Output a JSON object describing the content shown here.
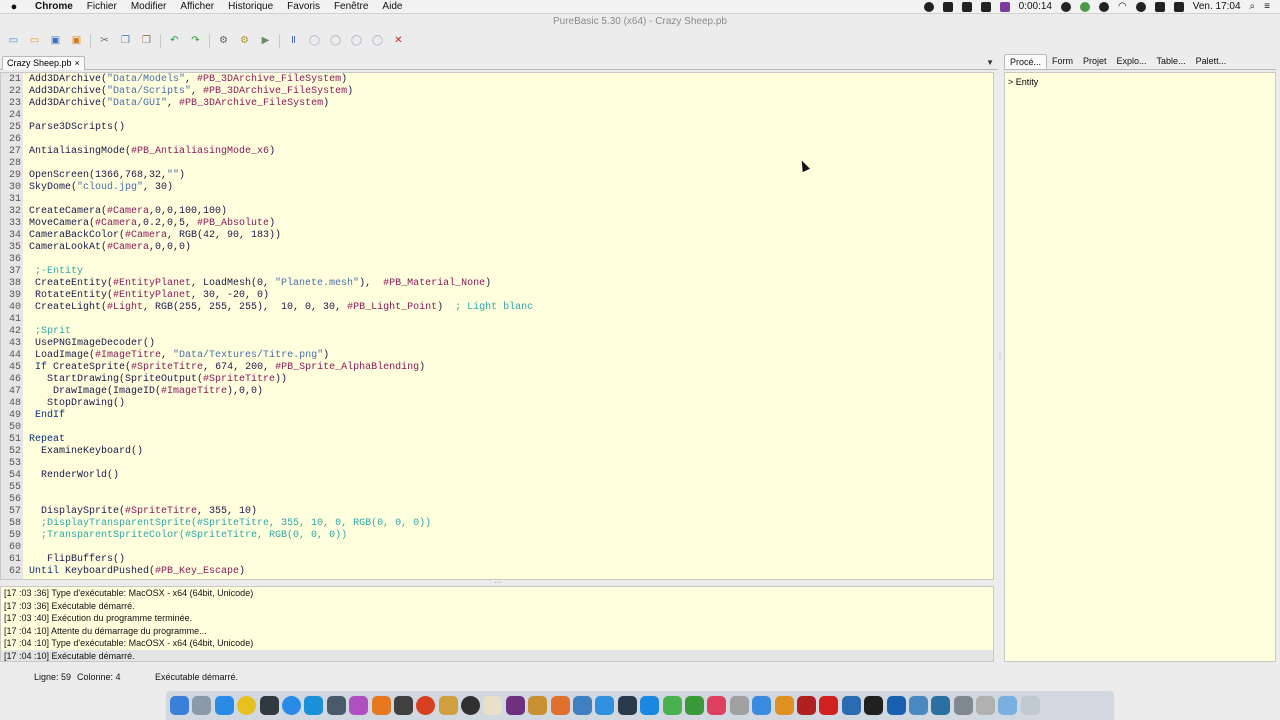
{
  "menubar": {
    "app": "Chrome",
    "items": [
      "Fichier",
      "Modifier",
      "Afficher",
      "Historique",
      "Favoris",
      "Fenêtre",
      "Aide"
    ],
    "timer": "0:00:14",
    "clock": "Ven. 17:04"
  },
  "window": {
    "title": "PureBasic 5.30 (x64) - Crazy Sheep.pb"
  },
  "toolbar": {
    "buttons": [
      {
        "name": "new-file-icon",
        "glyph": "▭",
        "color": "#4a7fd0"
      },
      {
        "name": "open-file-icon",
        "glyph": "▭",
        "color": "#e0a020"
      },
      {
        "name": "save-icon",
        "glyph": "▣",
        "color": "#3a70c0"
      },
      {
        "name": "save-all-icon",
        "glyph": "▣",
        "color": "#d08020"
      },
      {
        "name": "cut-icon",
        "glyph": "✂",
        "color": "#607080"
      },
      {
        "name": "copy-icon",
        "glyph": "❐",
        "color": "#5080c0"
      },
      {
        "name": "paste-icon",
        "glyph": "❐",
        "color": "#907050"
      },
      {
        "name": "undo-icon",
        "glyph": "↶",
        "color": "#2a9a3a"
      },
      {
        "name": "redo-icon",
        "glyph": "↷",
        "color": "#2a9a3a"
      },
      {
        "name": "compile-icon",
        "glyph": "⚙",
        "color": "#506070"
      },
      {
        "name": "debug-options-icon",
        "glyph": "⚙",
        "color": "#b09030"
      },
      {
        "name": "run-icon",
        "glyph": "▶",
        "color": "#6a8a6a"
      },
      {
        "name": "pause-icon",
        "glyph": "Ⅱ",
        "color": "#5070d0"
      },
      {
        "name": "stop-icon",
        "glyph": "◯",
        "color": "#9aa8c8"
      },
      {
        "name": "step-icon",
        "glyph": "◯",
        "color": "#9aa8c8"
      },
      {
        "name": "step-over-icon",
        "glyph": "◯",
        "color": "#9aa8c8"
      },
      {
        "name": "step-out-icon",
        "glyph": "◯",
        "color": "#9aa8c8"
      },
      {
        "name": "kill-icon",
        "glyph": "✕",
        "color": "#d02020"
      }
    ]
  },
  "editor": {
    "tab_label": "Crazy Sheep.pb",
    "tab_close": "×",
    "lines": [
      {
        "n": "21",
        "t": "Add3DArchive(\"Data/Models\", #PB_3DArchive_FileSystem)"
      },
      {
        "n": "22",
        "t": "Add3DArchive(\"Data/Scripts\", #PB_3DArchive_FileSystem)"
      },
      {
        "n": "23",
        "t": "Add3DArchive(\"Data/GUI\", #PB_3DArchive_FileSystem)"
      },
      {
        "n": "24",
        "t": ""
      },
      {
        "n": "25",
        "t": "Parse3DScripts()"
      },
      {
        "n": "26",
        "t": ""
      },
      {
        "n": "27",
        "t": "AntialiasingMode(#PB_AntialiasingMode_x6)"
      },
      {
        "n": "28",
        "t": ""
      },
      {
        "n": "29",
        "t": "OpenScreen(1366,768,32,\"\")"
      },
      {
        "n": "30",
        "t": "SkyDome(\"cloud.jpg\", 30)"
      },
      {
        "n": "31",
        "t": ""
      },
      {
        "n": "32",
        "t": "CreateCamera(#Camera,0,0,100,100)"
      },
      {
        "n": "33",
        "t": "MoveCamera(#Camera,0.2,0,5, #PB_Absolute)"
      },
      {
        "n": "34",
        "t": "CameraBackColor(#Camera, RGB(42, 90, 183))"
      },
      {
        "n": "35",
        "t": "CameraLookAt(#Camera,0,0,0)"
      },
      {
        "n": "36",
        "t": ""
      },
      {
        "n": "37",
        "t": " ;-Entity"
      },
      {
        "n": "38",
        "t": " CreateEntity(#EntityPlanet, LoadMesh(0, \"Planete.mesh\"),  #PB_Material_None)"
      },
      {
        "n": "39",
        "t": " RotateEntity(#EntityPlanet, 30, -20, 0)"
      },
      {
        "n": "40",
        "t": " CreateLight(#Light, RGB(255, 255, 255),  10, 0, 30, #PB_Light_Point)  ; Light blanc"
      },
      {
        "n": "41",
        "t": ""
      },
      {
        "n": "42",
        "t": " ;Sprit"
      },
      {
        "n": "43",
        "t": " UsePNGImageDecoder()"
      },
      {
        "n": "44",
        "t": " LoadImage(#ImageTitre, \"Data/Textures/Titre.png\")"
      },
      {
        "n": "45",
        "t": " If CreateSprite(#SpriteTitre, 674, 200, #PB_Sprite_AlphaBlending)"
      },
      {
        "n": "46",
        "t": "   StartDrawing(SpriteOutput(#SpriteTitre))"
      },
      {
        "n": "47",
        "t": "    DrawImage(ImageID(#ImageTitre),0,0)"
      },
      {
        "n": "48",
        "t": "   StopDrawing()"
      },
      {
        "n": "49",
        "t": " EndIf"
      },
      {
        "n": "50",
        "t": ""
      },
      {
        "n": "51",
        "t": "Repeat"
      },
      {
        "n": "52",
        "t": "  ExamineKeyboard()"
      },
      {
        "n": "53",
        "t": ""
      },
      {
        "n": "54",
        "t": "  RenderWorld()"
      },
      {
        "n": "55",
        "t": ""
      },
      {
        "n": "56",
        "t": ""
      },
      {
        "n": "57",
        "t": "  DisplaySprite(#SpriteTitre, 355, 10)"
      },
      {
        "n": "58",
        "t": "  ;DisplayTransparentSprite(#SpriteTitre, 355, 10, 0, RGB(0, 0, 0))"
      },
      {
        "n": "59",
        "t": "  ;TransparentSpriteColor(#SpriteTitre, RGB(0, 0, 0))"
      },
      {
        "n": "60",
        "t": ""
      },
      {
        "n": "61",
        "t": "   FlipBuffers()"
      },
      {
        "n": "62",
        "t": "Until KeyboardPushed(#PB_Key_Escape)"
      }
    ]
  },
  "log": {
    "lines": [
      "[17 :03 :36] Type d'exécutable: MacOSX - x64  (64bit, Unicode)",
      "[17 :03 :36] Exécutable démarré.",
      "[17 :03 :40] Exécution du programme terminée.",
      "[17 :04 :10] Attente du démarrage du programme...",
      "[17 :04 :10] Type d'exécutable: MacOSX - x64  (64bit, Unicode)",
      "[17 :04 :10] Exécutable démarré."
    ]
  },
  "panel": {
    "tabs": [
      "Procé...",
      "Form",
      "Projet",
      "Explo...",
      "Table...",
      "Palett..."
    ],
    "items": [
      "> Entity"
    ]
  },
  "status": {
    "line": "Ligne: 59",
    "column": "Colonne: 4",
    "message": "Exécutable démarré."
  },
  "dock": {
    "colors": [
      "#3a7fd8",
      "#8a9aaa",
      "#2a8ae8",
      "#e8c020",
      "#303840",
      "#2a8ae8",
      "#1a90d8",
      "#4a5a6a",
      "#b050c0",
      "#e87820",
      "#404040",
      "#d84020",
      "#d0a040",
      "#303030",
      "#e8e0c8",
      "#703080",
      "#c89030",
      "#e07030",
      "#4080c0",
      "#3090e0",
      "#2a3a4a",
      "#1a88e0",
      "#4ab050",
      "#3a9a3a",
      "#e04060",
      "#a0a0a0",
      "#3a8ae0",
      "#e09020",
      "#b02020",
      "#d02020",
      "#2a6ab0",
      "#202020",
      "#1a60b0",
      "#4a8ac0",
      "#2a70a0",
      "#808890",
      "#b0b0b0",
      "#7ab0e0",
      "#c0c8d0"
    ]
  }
}
